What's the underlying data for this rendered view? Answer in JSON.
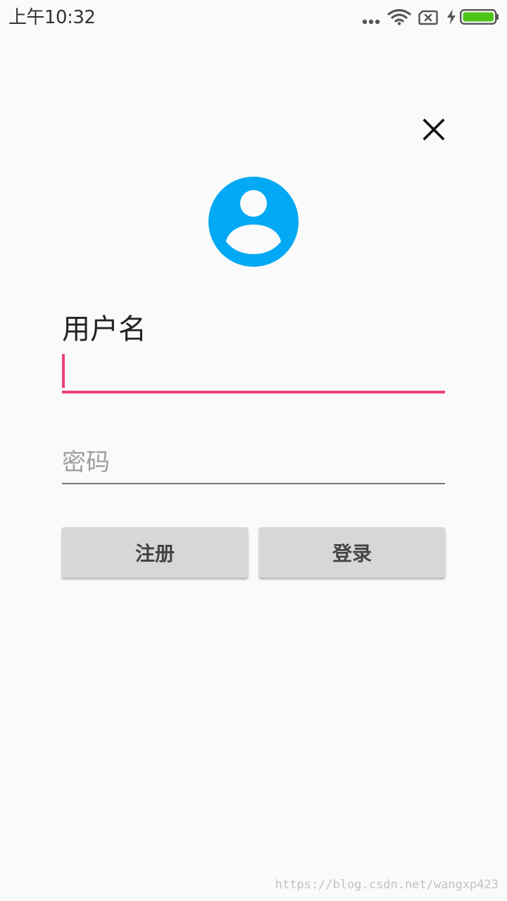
{
  "status_bar": {
    "time": "上午10:32",
    "icons": [
      "more-dots-icon",
      "wifi-icon",
      "no-sim-icon",
      "charging-bolt-icon",
      "battery-icon"
    ],
    "battery_color": "#4cc417"
  },
  "header": {
    "close_icon": "close-icon"
  },
  "avatar": {
    "icon": "account-circle-icon",
    "color": "#03a9f4"
  },
  "form": {
    "username": {
      "label": "用户名",
      "value": "",
      "accent_color": "#ec407a"
    },
    "password": {
      "placeholder": "密码",
      "value": ""
    }
  },
  "buttons": {
    "register_label": "注册",
    "login_label": "登录"
  },
  "watermark": {
    "text": "https://blog.csdn.net/wangxp423"
  }
}
